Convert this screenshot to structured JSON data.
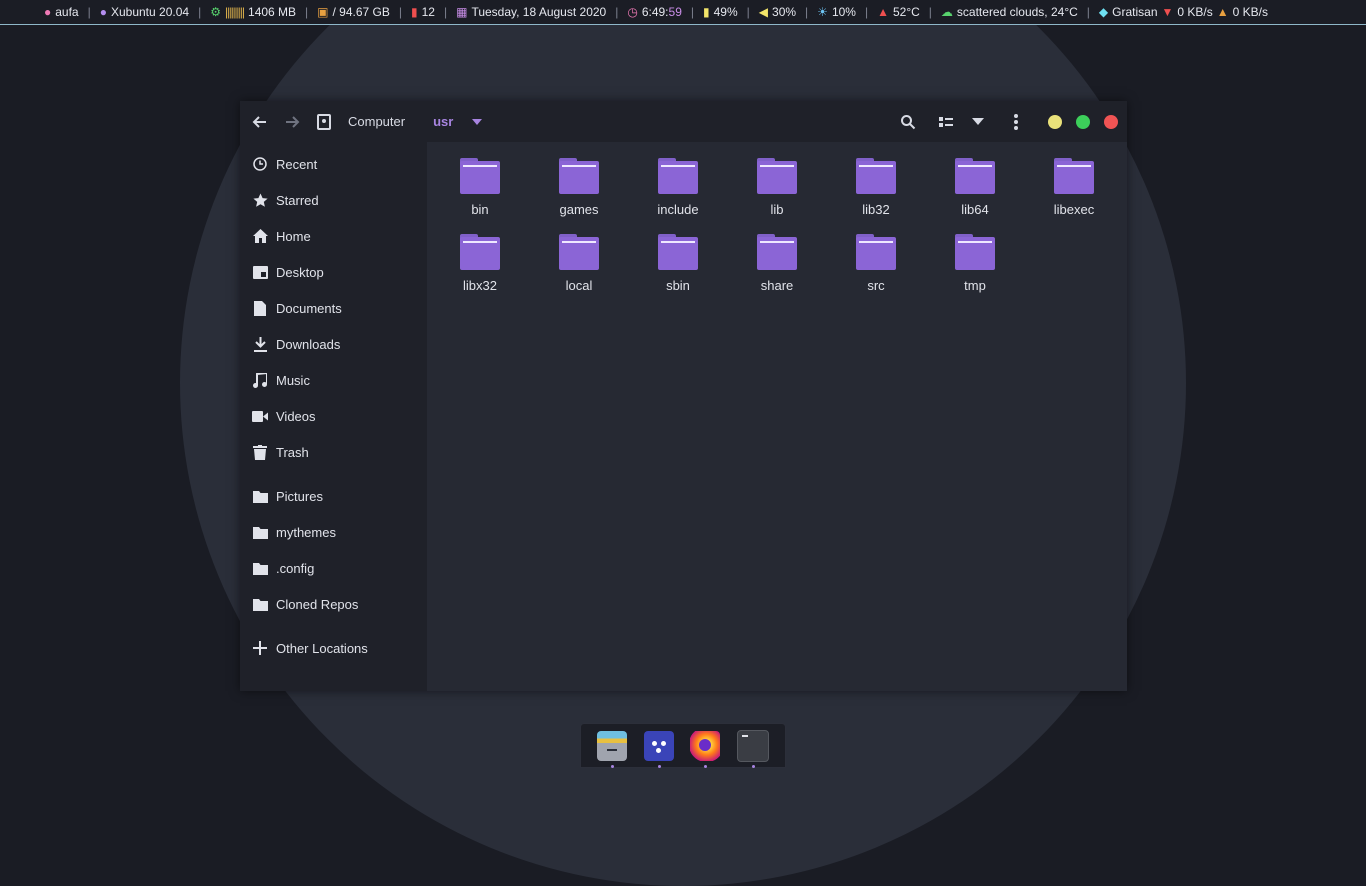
{
  "topbar": {
    "user": "aufa",
    "os": "Xubuntu 20.04",
    "memory": "1406 MB",
    "memory_bars": "|||||||||",
    "disk": "/ 94.67 GB",
    "updates": "12",
    "date": "Tuesday, 18 August 2020",
    "time_hm": "6:49:",
    "time_s": "59",
    "battery": "49%",
    "volume": "30%",
    "brightness": "10%",
    "temperature": "52°C",
    "weather": "scattered clouds, 24°C",
    "vpn": "Gratisan",
    "download": "0 KB/s",
    "upload": "0 KB/s",
    "sep": "|"
  },
  "headerbar": {
    "crumb_root": "Computer",
    "crumb_current": "usr"
  },
  "sidebar": {
    "items": [
      {
        "label": "Recent",
        "icon": "clock-icon"
      },
      {
        "label": "Starred",
        "icon": "star-icon"
      },
      {
        "label": "Home",
        "icon": "home-icon"
      },
      {
        "label": "Desktop",
        "icon": "desktop-icon"
      },
      {
        "label": "Documents",
        "icon": "document-icon"
      },
      {
        "label": "Downloads",
        "icon": "download-icon"
      },
      {
        "label": "Music",
        "icon": "music-icon"
      },
      {
        "label": "Videos",
        "icon": "video-icon"
      },
      {
        "label": "Trash",
        "icon": "trash-icon"
      },
      {
        "label": "Pictures",
        "icon": "folder-icon"
      },
      {
        "label": "mythemes",
        "icon": "folder-icon"
      },
      {
        "label": ".config",
        "icon": "folder-icon"
      },
      {
        "label": "Cloned Repos",
        "icon": "folder-icon"
      },
      {
        "label": "Other Locations",
        "icon": "plus-icon"
      }
    ]
  },
  "files": [
    "bin",
    "games",
    "include",
    "lib",
    "lib32",
    "lib64",
    "libexec",
    "libx32",
    "local",
    "sbin",
    "share",
    "src",
    "tmp"
  ],
  "colors": {
    "accent": "#a784e0",
    "folder": "#8b65d6",
    "close": "#f05454",
    "maximize": "#3ccf5a",
    "minimize": "#e9e17a"
  },
  "dock": {
    "apps": [
      "file-manager-icon",
      "app-icon",
      "firefox-icon",
      "terminal-icon"
    ]
  }
}
